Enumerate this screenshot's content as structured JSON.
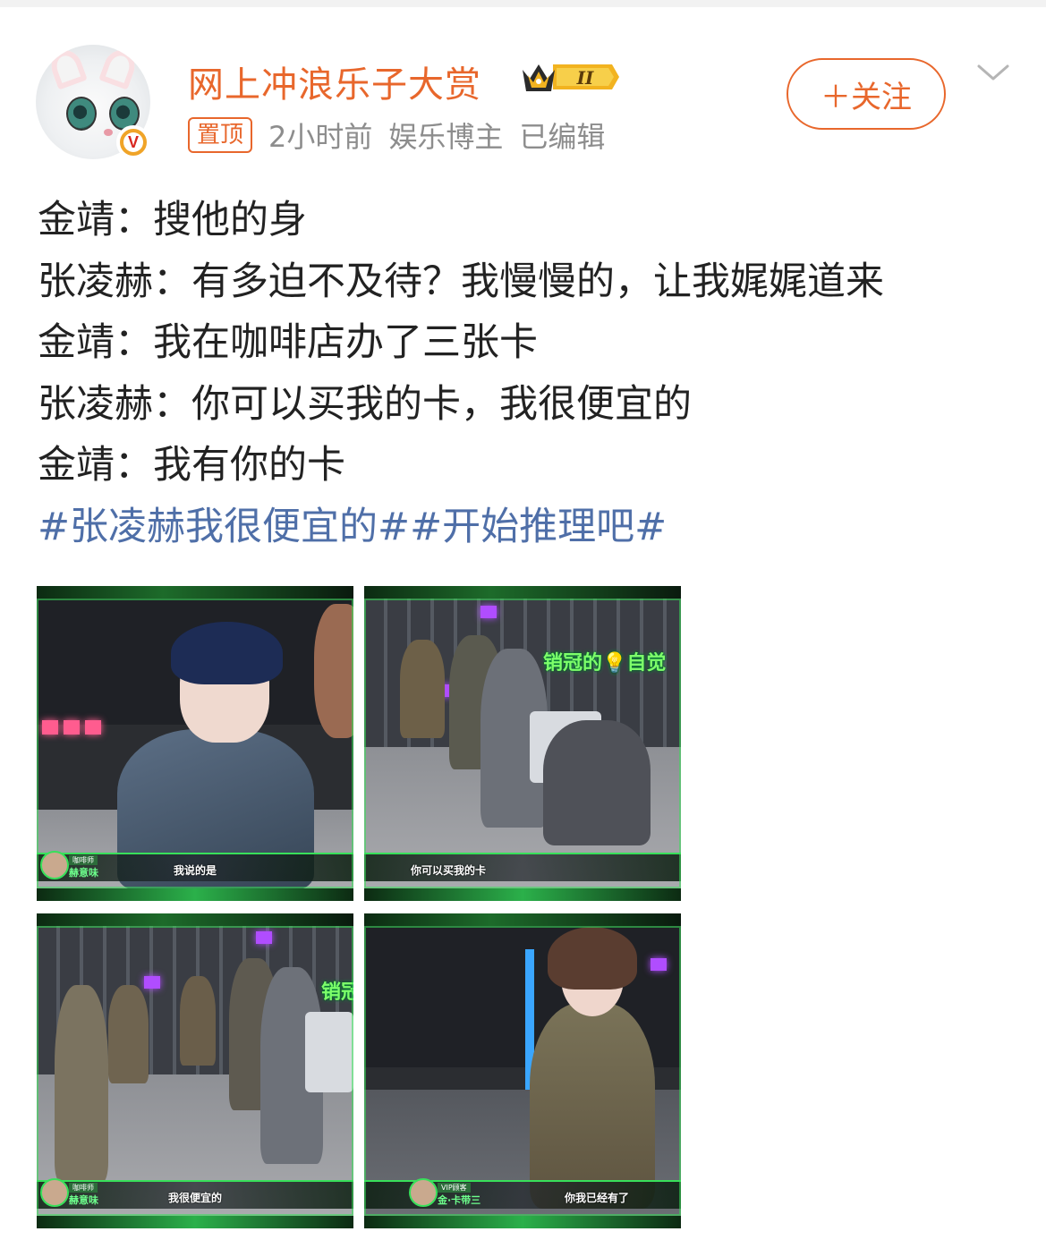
{
  "post": {
    "author": {
      "name": "网上冲浪乐子大赏",
      "level_badge": "II",
      "avatar_icon": "white-cat-avatar",
      "verified_icon": "verified-v-icon",
      "verified_mark": "V"
    },
    "meta": {
      "pinned_label": "置顶",
      "time": "2小时前",
      "category": "娱乐博主",
      "edited": "已编辑"
    },
    "follow_button": "＋关注",
    "menu_icon": "chevron-down-icon",
    "lines": [
      "金靖：搜他的身",
      "张凌赫：有多迫不及待？我慢慢的，让我娓娓道来",
      "金靖：我在咖啡店办了三张卡",
      "张凌赫：你可以买我的卡，我很便宜的",
      "金靖：我有你的卡"
    ],
    "hashtags": [
      "#张凌赫我很便宜的#",
      "#开始推理吧#"
    ],
    "images": [
      {
        "caption": "我说的是",
        "tag": "咖啡师",
        "name": "赫意味"
      },
      {
        "caption": "你可以买我的卡",
        "overlay": "销冠的💡自觉"
      },
      {
        "caption": "我很便宜的",
        "tag": "咖啡师",
        "name": "赫意味",
        "overlay": "销冠"
      },
      {
        "caption": "你我已经有了",
        "tag": "VIP顾客",
        "name": "金·卡带三"
      }
    ]
  },
  "colors": {
    "accent": "#e8672c",
    "hashtag": "#4f6fa8",
    "meta": "#8d8d8d",
    "overlay_green": "#38e05a"
  }
}
